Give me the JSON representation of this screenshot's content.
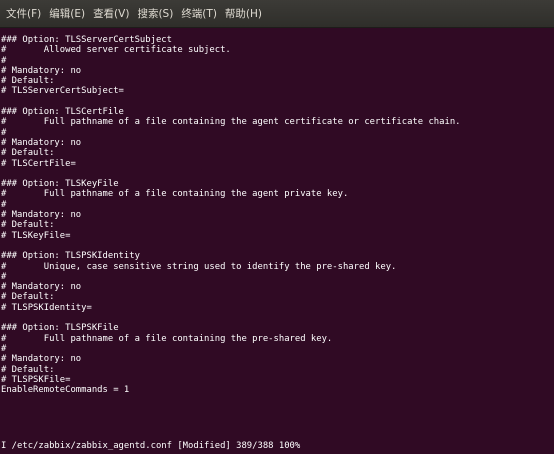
{
  "menubar": {
    "items": [
      {
        "label": "文件(F)"
      },
      {
        "label": "编辑(E)"
      },
      {
        "label": "查看(V)"
      },
      {
        "label": "搜索(S)"
      },
      {
        "label": "终端(T)"
      },
      {
        "label": "帮助(H)"
      }
    ]
  },
  "terminal": {
    "lines": [
      "### Option: TLSServerCertSubject",
      "#       Allowed server certificate subject.",
      "#",
      "# Mandatory: no",
      "# Default:",
      "# TLSServerCertSubject=",
      "",
      "### Option: TLSCertFile",
      "#       Full pathname of a file containing the agent certificate or certificate chain.",
      "#",
      "# Mandatory: no",
      "# Default:",
      "# TLSCertFile=",
      "",
      "### Option: TLSKeyFile",
      "#       Full pathname of a file containing the agent private key.",
      "#",
      "# Mandatory: no",
      "# Default:",
      "# TLSKeyFile=",
      "",
      "### Option: TLSPSKIdentity",
      "#       Unique, case sensitive string used to identify the pre-shared key.",
      "#",
      "# Mandatory: no",
      "# Default:",
      "# TLSPSKIdentity=",
      "",
      "### Option: TLSPSKFile",
      "#       Full pathname of a file containing the pre-shared key.",
      "#",
      "# Mandatory: no",
      "# Default:",
      "# TLSPSKFile=",
      "EnableRemoteCommands = 1"
    ]
  },
  "status": {
    "mode": "I",
    "text": " /etc/zabbix/zabbix_agentd.conf [Modified] 389/388 100%"
  },
  "colors": {
    "background": "#300a24",
    "menubar": "#3c3b37",
    "text": "#ffffff",
    "menu_text": "#dfdbd2"
  }
}
